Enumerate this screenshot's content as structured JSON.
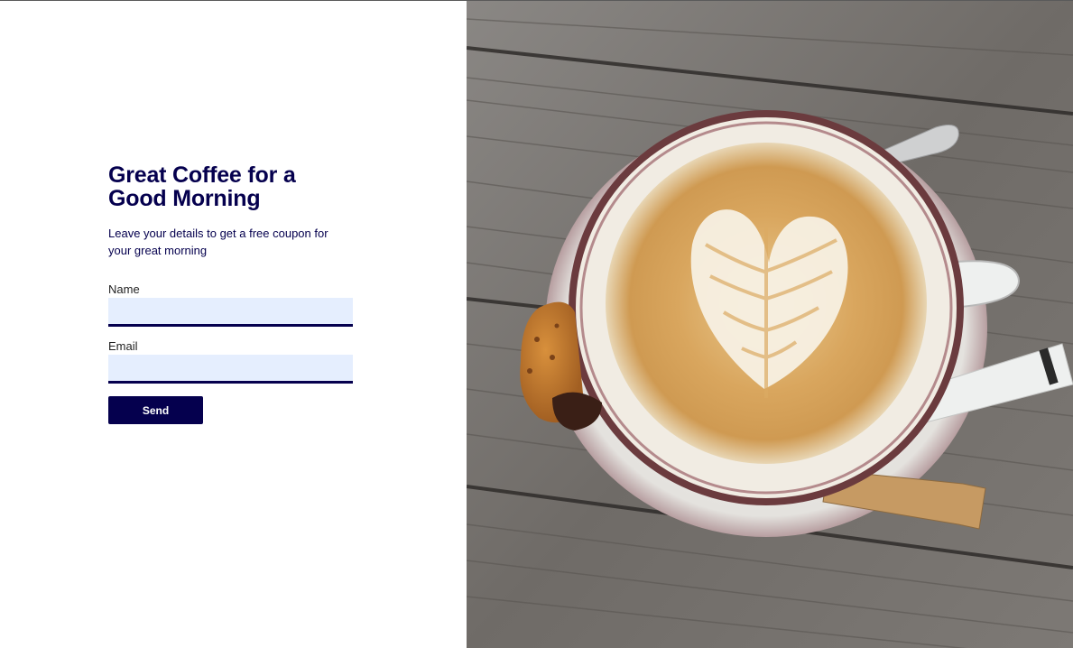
{
  "form": {
    "title": "Great Coffee for a Good Morning",
    "subtitle": "Leave your details to get a free coupon for your great morning",
    "name_label": "Name",
    "name_value": "",
    "email_label": "Email",
    "email_value": "",
    "send_label": "Send"
  },
  "colors": {
    "primary": "#05004e",
    "input_bg": "#e5eefe"
  },
  "image": {
    "subject": "latte-art-coffee-cup-on-wooden-table"
  }
}
